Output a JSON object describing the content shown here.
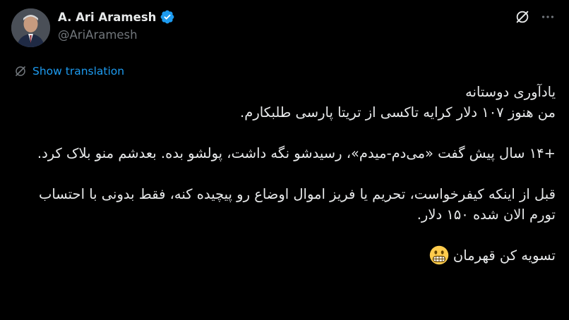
{
  "author": {
    "display_name": "A. Ari Aramesh",
    "handle": "@AriAramesh",
    "verified": true,
    "verified_color": "#1d9bf0"
  },
  "header_icons": [
    "grok-icon",
    "more-icon"
  ],
  "translation": {
    "label": "Show translation",
    "color": "#1d9bf0"
  },
  "tweet": {
    "line1": "یادآوری دوستانه",
    "line2": "من هنوز ۱۰۷ دلار کرایه تاکسی از تریتا پارسی طلبکارم.",
    "para2": "+۱۴ سال پیش گفت «می‌دم-میدم»، رسیدشو نگه داشت، پولشو بده. بعدشم منو بلاک کرد.",
    "para3": "قبل از اینکه کیفرخواست، تحریم یا فریز اموال اوضاع رو پیچیده کنه، فقط بدونی با احتساب تورم الان شده ۱۵۰ دلار.",
    "line_last": "تسویه کن قهرمان",
    "emoji": "grimacing-face"
  },
  "colors": {
    "background": "#000000",
    "text": "#e7e9ea",
    "secondary": "#71767b",
    "accent": "#1d9bf0"
  }
}
